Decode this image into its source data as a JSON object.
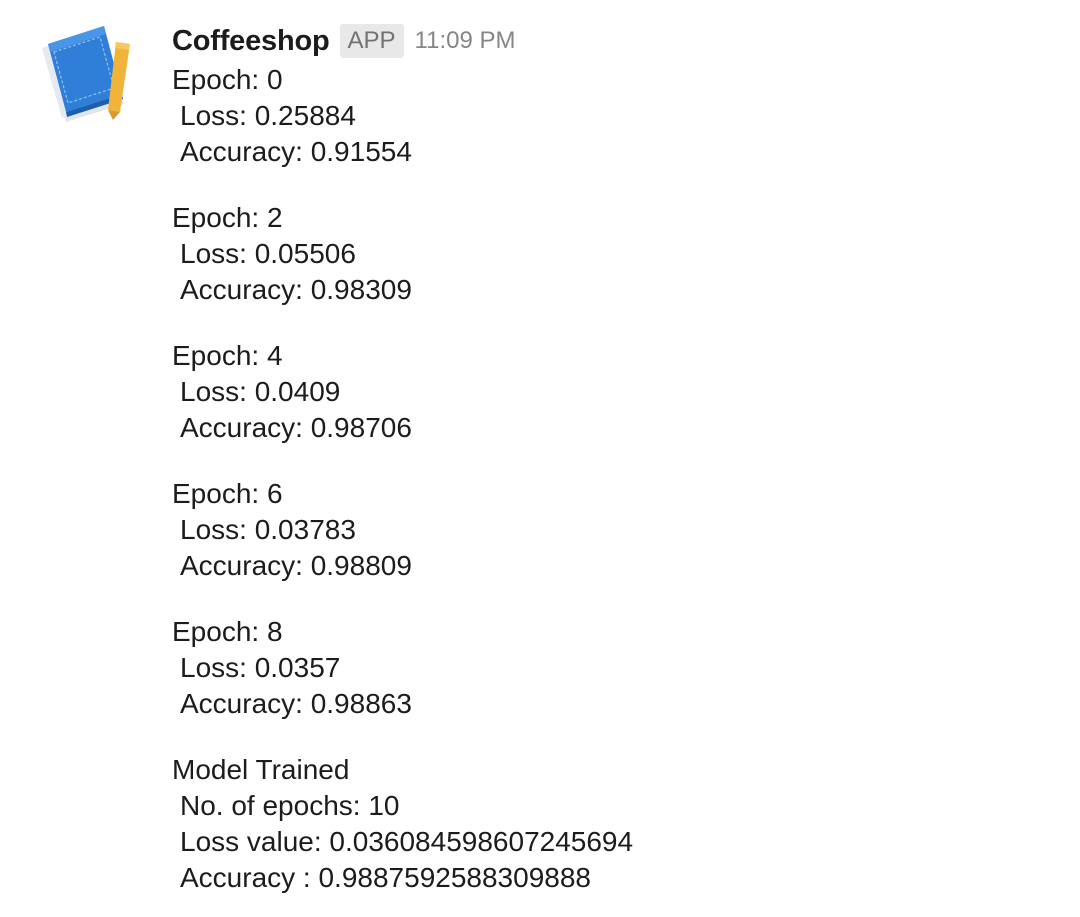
{
  "message": {
    "sender": "Coffeeshop",
    "badge": "APP",
    "time": "11:09 PM"
  },
  "avatar": {
    "icon": "notebook-pencil-icon",
    "colors": {
      "book": "#2f7fd8",
      "book_dark": "#1c5fb0",
      "pages": "#e6e9ee",
      "pencil": "#f0b43a"
    }
  },
  "epochs": [
    {
      "epoch": "Epoch: 0",
      "loss": "Loss: 0.25884",
      "accuracy": "Accuracy: 0.91554"
    },
    {
      "epoch": "Epoch: 2",
      "loss": "Loss: 0.05506",
      "accuracy": "Accuracy: 0.98309"
    },
    {
      "epoch": "Epoch: 4",
      "loss": "Loss: 0.0409",
      "accuracy": "Accuracy: 0.98706"
    },
    {
      "epoch": "Epoch: 6",
      "loss": "Loss: 0.03783",
      "accuracy": "Accuracy: 0.98809"
    },
    {
      "epoch": "Epoch: 8",
      "loss": "Loss: 0.0357",
      "accuracy": "Accuracy: 0.98863"
    }
  ],
  "summary": {
    "title": "Model Trained",
    "epochs": "No. of epochs: 10",
    "loss": "Loss value: 0.036084598607245694",
    "accuracy": "Accuracy : 0.9887592588309888"
  }
}
